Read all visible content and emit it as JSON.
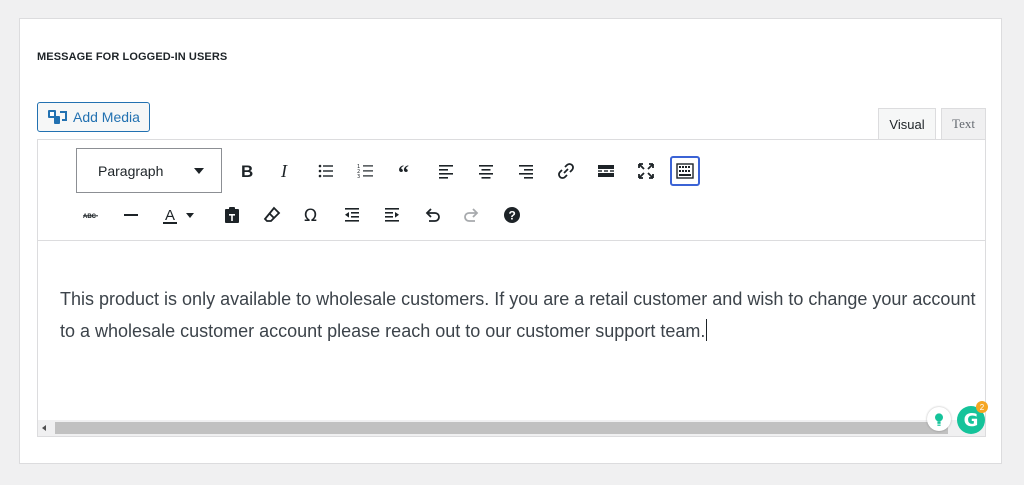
{
  "section": {
    "title": "MESSAGE FOR LOGGED-IN USERS"
  },
  "media": {
    "add_label": "Add Media"
  },
  "tabs": {
    "visual": "Visual",
    "text": "Text"
  },
  "toolbar": {
    "format_value": "Paragraph",
    "row1": [
      "bold-icon",
      "italic-icon",
      "bullet-list-icon",
      "numbered-list-icon",
      "blockquote-icon",
      "align-left-icon",
      "align-center-icon",
      "align-right-icon",
      "link-icon",
      "read-more-icon",
      "fullscreen-icon",
      "toolbar-toggle-icon"
    ],
    "row2": [
      "strikethrough-icon",
      "horizontal-line-icon",
      "text-color-icon",
      "paste-as-text-icon",
      "clear-formatting-icon",
      "special-character-icon",
      "outdent-icon",
      "indent-icon",
      "undo-icon",
      "redo-icon",
      "help-icon"
    ],
    "text_color_letter": "A"
  },
  "content": {
    "body": "This product is only available to wholesale customers. If you are a retail customer and wish to change your account to a wholesale customer account please reach out to our customer support team."
  },
  "grammarly": {
    "logo_letter": "G",
    "badge_count": "2"
  },
  "colors": {
    "accent": "#2271b1",
    "toolbar_active": "#3b63d5",
    "grammarly": "#15c39a",
    "badge": "#f5a623"
  }
}
